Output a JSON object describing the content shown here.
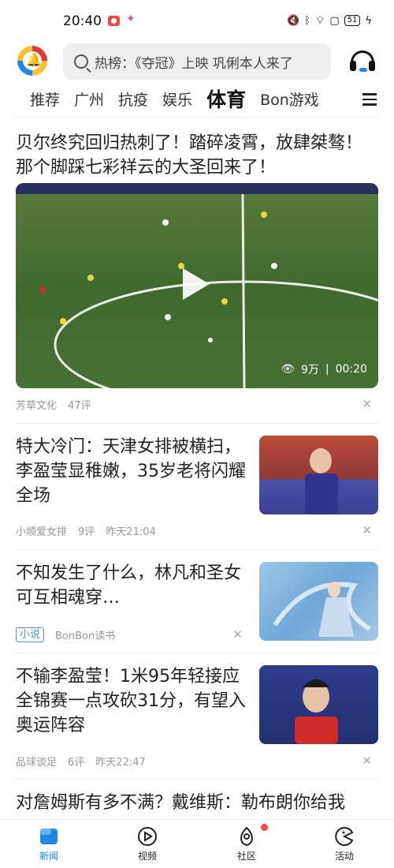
{
  "status": {
    "time": "20:40",
    "battery": "51"
  },
  "header": {
    "search_text": "热榜：《夺冠》上映 巩俐本人来了"
  },
  "tabs": [
    "推荐",
    "广州",
    "抗疫",
    "娱乐",
    "体育",
    "Bon游戏"
  ],
  "feed": {
    "top": {
      "title": "贝尔终究回归热刺了！踏碎凌霄，放肆桀骜！那个脚踩七彩祥云的大圣回来了！",
      "views": "9万",
      "duration": "00:20",
      "source": "芳草文化",
      "comments": "47评"
    },
    "items": [
      {
        "title": "特大冷门：天津女排被横扫，李盈莹显稚嫩，35岁老将闪耀全场",
        "source": "小顺爱女排",
        "comments": "9评",
        "time": "昨天21:04"
      },
      {
        "title": "不知发生了什么，林凡和圣女可互相魂穿…",
        "tag": "小说",
        "source": "BonBon读书"
      },
      {
        "title": "不输李盈莹！1米95年轻接应全锦赛一点攻砍31分，有望入奥运阵容",
        "source": "品球谈足",
        "comments": "6评",
        "time": "昨天22:47"
      },
      {
        "title": "对詹姆斯有多不满？戴维斯：勒布朗你给我"
      }
    ]
  },
  "bottom_nav": [
    {
      "label": "新闻",
      "icon": "news-icon"
    },
    {
      "label": "视频",
      "icon": "video-icon"
    },
    {
      "label": "社区",
      "icon": "community-icon"
    },
    {
      "label": "活动",
      "icon": "activity-icon"
    }
  ],
  "colors": {
    "accent": "#1e88e5",
    "badge": "#f04848"
  }
}
